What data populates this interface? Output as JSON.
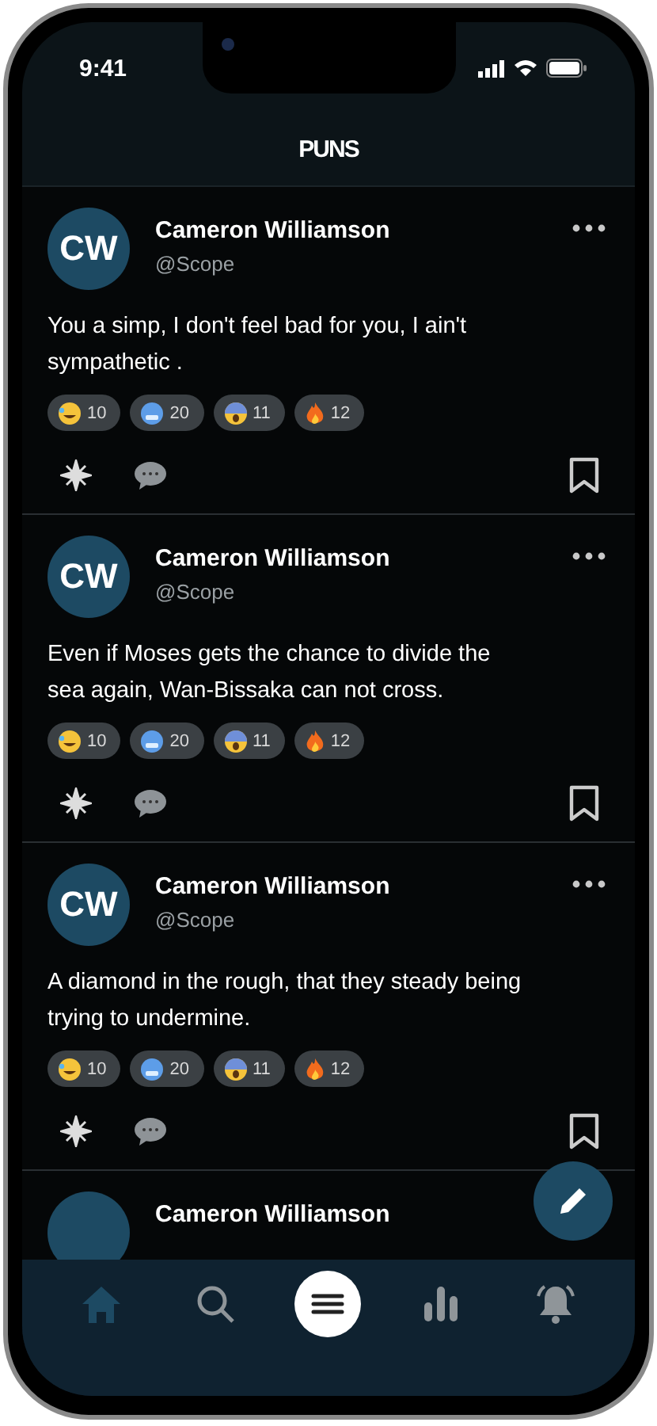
{
  "status_bar": {
    "time": "9:41"
  },
  "header": {
    "title": "PUNS"
  },
  "posts": [
    {
      "initials": "CW",
      "name": "Cameron Williamson",
      "handle": "@Scope",
      "text": "You a simp, I don't feel bad for you, I ain't sympathetic .",
      "reactions": [
        {
          "kind": "laugh",
          "count": "10"
        },
        {
          "kind": "cold",
          "count": "20"
        },
        {
          "kind": "scream",
          "count": "11"
        },
        {
          "kind": "fire",
          "count": "12"
        }
      ]
    },
    {
      "initials": "CW",
      "name": "Cameron Williamson",
      "handle": "@Scope",
      "text": "Even if Moses gets the chance to divide the sea again, Wan-Bissaka can not cross.",
      "reactions": [
        {
          "kind": "laugh",
          "count": "10"
        },
        {
          "kind": "cold",
          "count": "20"
        },
        {
          "kind": "scream",
          "count": "11"
        },
        {
          "kind": "fire",
          "count": "12"
        }
      ]
    },
    {
      "initials": "CW",
      "name": "Cameron Williamson",
      "handle": "@Scope",
      "text": "A diamond in the rough, that they steady being trying to undermine.",
      "reactions": [
        {
          "kind": "laugh",
          "count": "10"
        },
        {
          "kind": "cold",
          "count": "20"
        },
        {
          "kind": "scream",
          "count": "11"
        },
        {
          "kind": "fire",
          "count": "12"
        }
      ]
    }
  ],
  "peek_post": {
    "name": "Cameron Williamson"
  },
  "nav": [
    {
      "kind": "home",
      "selected": true
    },
    {
      "kind": "search",
      "selected": false
    },
    {
      "kind": "menu",
      "selected": false
    },
    {
      "kind": "stats",
      "selected": false
    },
    {
      "kind": "bell",
      "selected": false
    }
  ]
}
